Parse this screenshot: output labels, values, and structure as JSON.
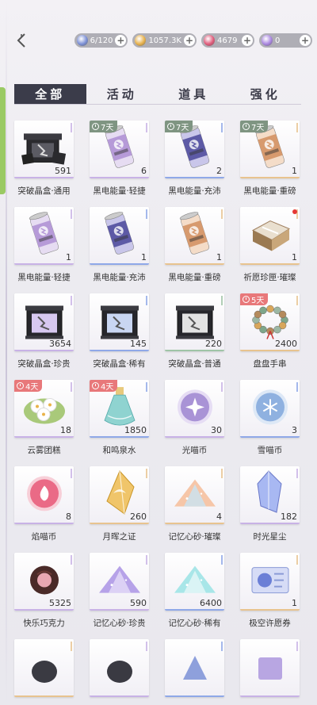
{
  "topbar": {
    "resources": [
      {
        "name": "stamina",
        "value": "6/120",
        "icon": "lightning-icon",
        "color": "#7b8fd6"
      },
      {
        "name": "gold",
        "value": "1057.3K",
        "icon": "diamond-gold-icon",
        "color": "#e7b04a"
      },
      {
        "name": "ruby",
        "value": "4679",
        "icon": "gem-red-icon",
        "color": "#e05a7a"
      },
      {
        "name": "crystal",
        "value": "0",
        "icon": "gem-purple-icon",
        "color": "#a985e0"
      }
    ]
  },
  "tabs": [
    {
      "label": "全部",
      "active": true
    },
    {
      "label": "活动",
      "active": false
    },
    {
      "label": "道具",
      "active": false
    },
    {
      "label": "强化",
      "active": false
    }
  ],
  "items": [
    {
      "name": "突破晶盒·通用",
      "count": "591",
      "badge": "",
      "art": "box-dark",
      "rarity": "#c8b2e6"
    },
    {
      "name": "黑电能量·轻捷",
      "count": "6",
      "badge": "7天",
      "badge_color": "green",
      "art": "can-purple",
      "rarity": "#c8b2e6"
    },
    {
      "name": "黑电能量·充沛",
      "count": "2",
      "badge": "7天",
      "badge_color": "green",
      "art": "can-indigo",
      "rarity": "#8fa8e8"
    },
    {
      "name": "黑电能量·重磅",
      "count": "1",
      "badge": "7天",
      "badge_color": "green",
      "art": "can-orange",
      "rarity": "#e8c38f"
    },
    {
      "name": "黑电能量·轻捷",
      "count": "1",
      "badge": "",
      "art": "can-purple",
      "rarity": "#c8b2e6"
    },
    {
      "name": "黑电能量·充沛",
      "count": "1",
      "badge": "",
      "art": "can-indigo",
      "rarity": "#8fa8e8"
    },
    {
      "name": "黑电能量·重磅",
      "count": "1",
      "badge": "",
      "art": "can-orange",
      "rarity": "#e8c38f"
    },
    {
      "name": "祈愿珍匣·璀璨",
      "count": "1",
      "badge": "",
      "reddot": true,
      "art": "chest-gold",
      "rarity": "#e8c38f"
    },
    {
      "name": "突破晶盒·珍贵",
      "count": "3654",
      "badge": "",
      "art": "box-purple",
      "rarity": "#c8b2e6"
    },
    {
      "name": "突破晶盒·稀有",
      "count": "145",
      "badge": "",
      "art": "box-blue",
      "rarity": "#8fa8e8"
    },
    {
      "name": "突破晶盒·普通",
      "count": "220",
      "badge": "",
      "art": "box-grey",
      "rarity": "#9fc4a6"
    },
    {
      "name": "盘盘手串",
      "count": "2400",
      "badge": "5天",
      "badge_color": "red",
      "art": "bracelet",
      "rarity": "#e8c38f"
    },
    {
      "name": "云雾团糕",
      "count": "18",
      "badge": "4天",
      "badge_color": "red",
      "art": "cakes",
      "rarity": "#c8b2e6"
    },
    {
      "name": "和鸣泉水",
      "count": "1850",
      "badge": "4天",
      "badge_color": "red",
      "art": "bottle",
      "rarity": "#8fa8e8"
    },
    {
      "name": "光喵币",
      "count": "30",
      "badge": "",
      "art": "coin-purple",
      "rarity": "#c8b2e6"
    },
    {
      "name": "雪喵币",
      "count": "3",
      "badge": "",
      "art": "coin-blue",
      "rarity": "#8fa8e8"
    },
    {
      "name": "焰喵币",
      "count": "8",
      "badge": "",
      "art": "coin-red",
      "rarity": "#c8b2e6"
    },
    {
      "name": "月晖之证",
      "count": "260",
      "badge": "",
      "art": "crystal-gold",
      "rarity": "#e8c38f"
    },
    {
      "name": "记忆心砂·璀璨",
      "count": "4",
      "badge": "",
      "art": "sand-rainbow",
      "rarity": "#e8c38f"
    },
    {
      "name": "时光星尘",
      "count": "182",
      "badge": "",
      "art": "crystal-blue",
      "rarity": "#c8b2e6"
    },
    {
      "name": "快乐巧克力",
      "count": "5325",
      "badge": "",
      "art": "chocolate",
      "rarity": "#c8b2e6"
    },
    {
      "name": "记忆心砂·珍贵",
      "count": "590",
      "badge": "",
      "art": "sand-purple",
      "rarity": "#c8b2e6"
    },
    {
      "name": "记忆心砂·稀有",
      "count": "6400",
      "badge": "",
      "art": "sand-cyan",
      "rarity": "#8fa8e8"
    },
    {
      "name": "极空许愿券",
      "count": "1",
      "badge": "",
      "art": "ticket",
      "rarity": "#e8c38f"
    },
    {
      "name": "",
      "count": "",
      "badge": "",
      "art": "partial-dark",
      "rarity": "#e8c38f"
    },
    {
      "name": "",
      "count": "",
      "badge": "",
      "art": "partial-dark2",
      "rarity": "#c8b2e6"
    },
    {
      "name": "",
      "count": "",
      "badge": "",
      "art": "partial-blue",
      "rarity": "#8fa8e8"
    },
    {
      "name": "",
      "count": "",
      "badge": "",
      "art": "partial-purple",
      "rarity": "#c8b2e6"
    }
  ]
}
